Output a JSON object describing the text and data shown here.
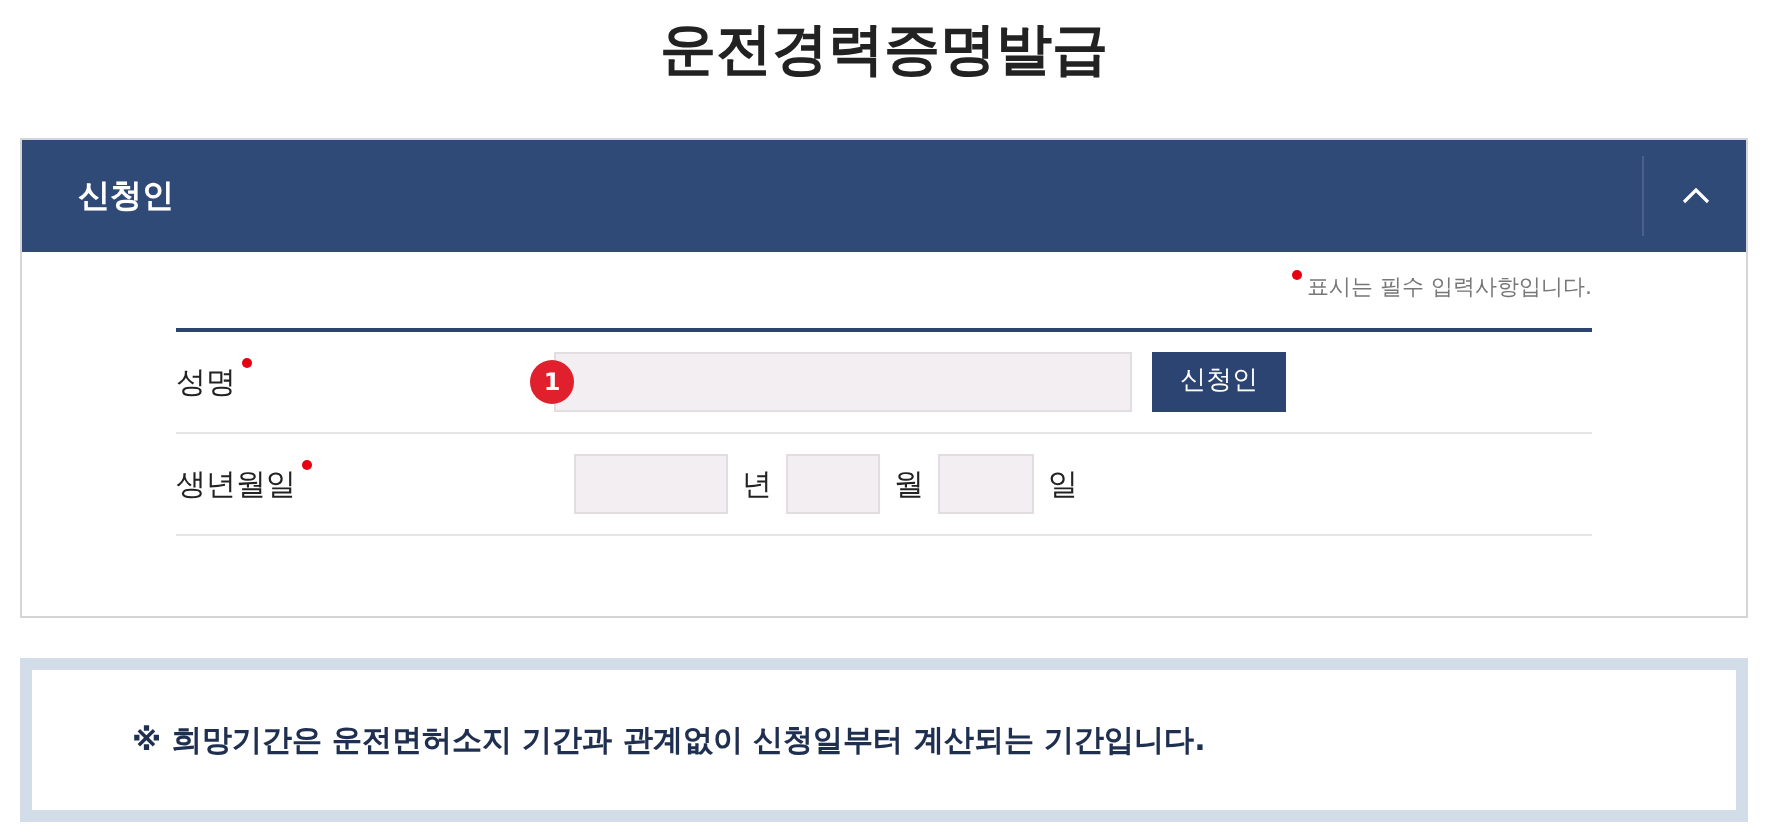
{
  "title": "운전경력증명발급",
  "panel": {
    "title": "신청인",
    "expanded": true
  },
  "required_note": "표시는 필수 입력사항입니다.",
  "fields": [
    {
      "kind": "text",
      "label": "성명",
      "required": true,
      "step": "1",
      "button": "신청인"
    },
    {
      "kind": "date",
      "label": "생년월일",
      "required": true,
      "units": [
        "년",
        "월",
        "일"
      ]
    }
  ],
  "notice": "※ 희망기간은 운전면허소지 기간과 관계없이 신청일부터 계산되는 기간입니다."
}
